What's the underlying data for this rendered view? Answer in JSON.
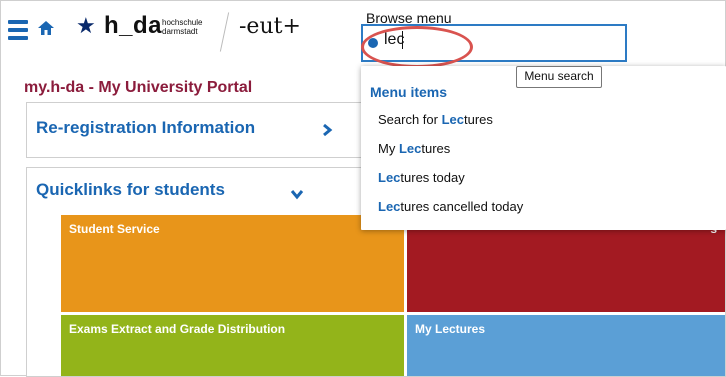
{
  "header": {
    "logo_main": "h_da",
    "logo_sub_line1": "hochschule",
    "logo_sub_line2": "darmstadt",
    "eut_logo": "-eut+",
    "star": "★"
  },
  "search": {
    "label": "Browse menu",
    "value": "lec",
    "tooltip": "Menu search"
  },
  "dropdown": {
    "heading": "Menu items",
    "items": [
      {
        "before": "Search for ",
        "match": "Lec",
        "after": "tures"
      },
      {
        "before": "My ",
        "match": "Lec",
        "after": "tures"
      },
      {
        "before": "",
        "match": "Lec",
        "after": "tures today"
      },
      {
        "before": "",
        "match": "Lec",
        "after": "tures cancelled today"
      }
    ]
  },
  "page": {
    "title": "my.h-da - My University Portal"
  },
  "panels": {
    "reregistration": "Re-registration Information",
    "quicklinks": "Quicklinks for students"
  },
  "tiles": {
    "student_service": "Student Service",
    "right_top_fragment": "s",
    "exams": "Exams Extract and Grade Distribution",
    "my_lectures": "My Lectures"
  },
  "colors": {
    "accent_blue": "#1a66b2",
    "title_maroon": "#8b1c3c",
    "orange_tile": "#e8951a",
    "red_tile": "#a31a22",
    "green_tile": "#93b41a",
    "lightblue_tile": "#5b9fd6",
    "highlight_red": "#d9534f"
  }
}
